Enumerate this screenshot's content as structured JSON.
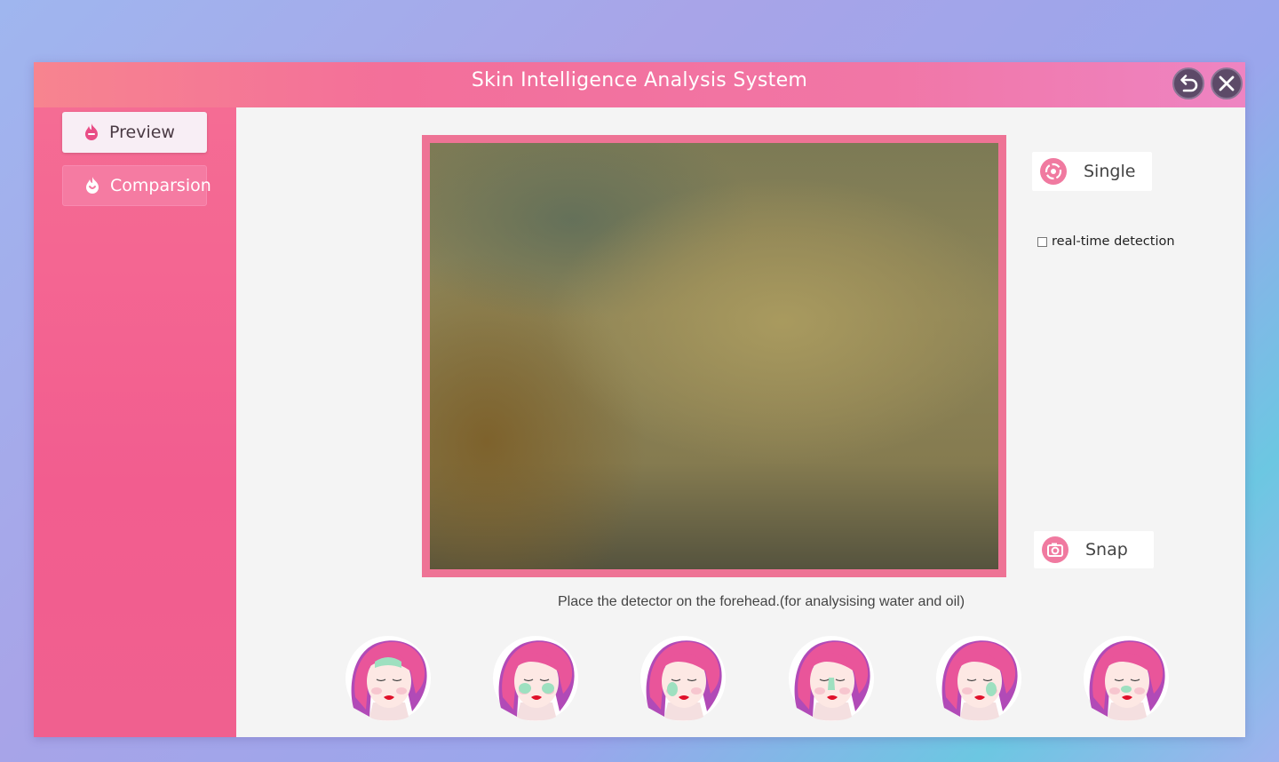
{
  "window": {
    "title": "Skin Intelligence Analysis System",
    "buttons": {
      "back_icon": "undo-arrow-icon",
      "close_icon": "close-icon"
    }
  },
  "sidebar": {
    "items": [
      {
        "label": "Preview",
        "icon": "flame-icon",
        "active": true
      },
      {
        "label": "Comparsion",
        "icon": "flame-icon",
        "active": false
      }
    ]
  },
  "main": {
    "single_label": "Single",
    "realtime_label": "real-time detection",
    "realtime_checked": false,
    "snap_label": "Snap",
    "hint": "Place the detector on the forehead.(for analysising water and oil)",
    "faces": [
      {
        "zone": "forehead"
      },
      {
        "zone": "cheeks"
      },
      {
        "zone": "left-cheek"
      },
      {
        "zone": "nose"
      },
      {
        "zone": "right-cheek"
      },
      {
        "zone": "chin"
      }
    ]
  },
  "colors": {
    "accent": "#f0608f",
    "frame": "#ee7395",
    "zone": "#9ee0c0"
  }
}
